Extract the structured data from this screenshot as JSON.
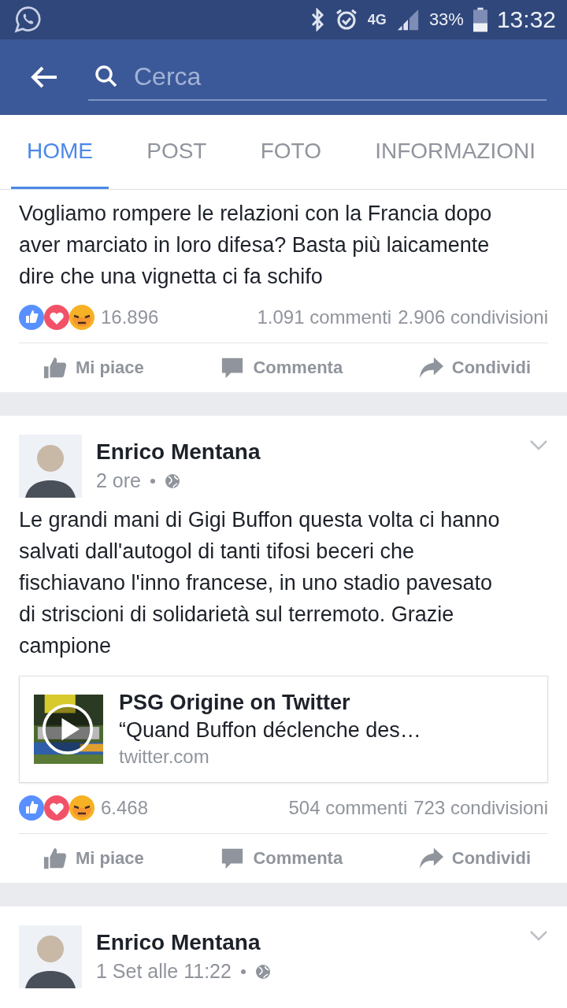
{
  "status_bar": {
    "network": "4G",
    "battery": "33%",
    "time": "13:32"
  },
  "header": {
    "search": {
      "placeholder": "Cerca"
    }
  },
  "tabs": [
    {
      "label": "HOME",
      "selected": true
    },
    {
      "label": "POST",
      "selected": false
    },
    {
      "label": "FOTO",
      "selected": false
    },
    {
      "label": "INFORMAZIONI",
      "selected": false
    }
  ],
  "posts": [
    {
      "kind": "continuation",
      "text": "Vogliamo rompere le relazioni con la Francia dopo aver marciato in loro difesa? Basta più laicamente dire che una vignetta ci fa schifo",
      "reactions": "16.896",
      "comments": "1.091 commenti",
      "shares": "2.906 condivisioni",
      "actions": [
        {
          "kind": "like",
          "label": "Mi piace"
        },
        {
          "kind": "comment",
          "label": "Commenta"
        },
        {
          "kind": "share",
          "label": "Condividi"
        }
      ]
    },
    {
      "kind": "post",
      "author": "Enrico Mentana",
      "time": "2 ore",
      "text": "Le grandi mani di Gigi Buffon questa volta ci hanno salvati dall'autogol di tanti tifosi beceri che fischiavano l'inno francese, in uno stadio pavesato di striscioni di solidarietà sul terremoto. Grazie campione",
      "link": {
        "title": "PSG Origine on Twitter",
        "description": "“Quand Buffon déclenche des…",
        "domain": "twitter.com"
      },
      "reactions": "6.468",
      "comments": "504 commenti",
      "shares": "723 condivisioni",
      "actions": [
        {
          "kind": "like",
          "label": "Mi piace"
        },
        {
          "kind": "comment",
          "label": "Commenta"
        },
        {
          "kind": "share",
          "label": "Condividi"
        }
      ]
    },
    {
      "kind": "post",
      "author": "Enrico Mentana",
      "time": "1 Set alle 11:22"
    }
  ]
}
